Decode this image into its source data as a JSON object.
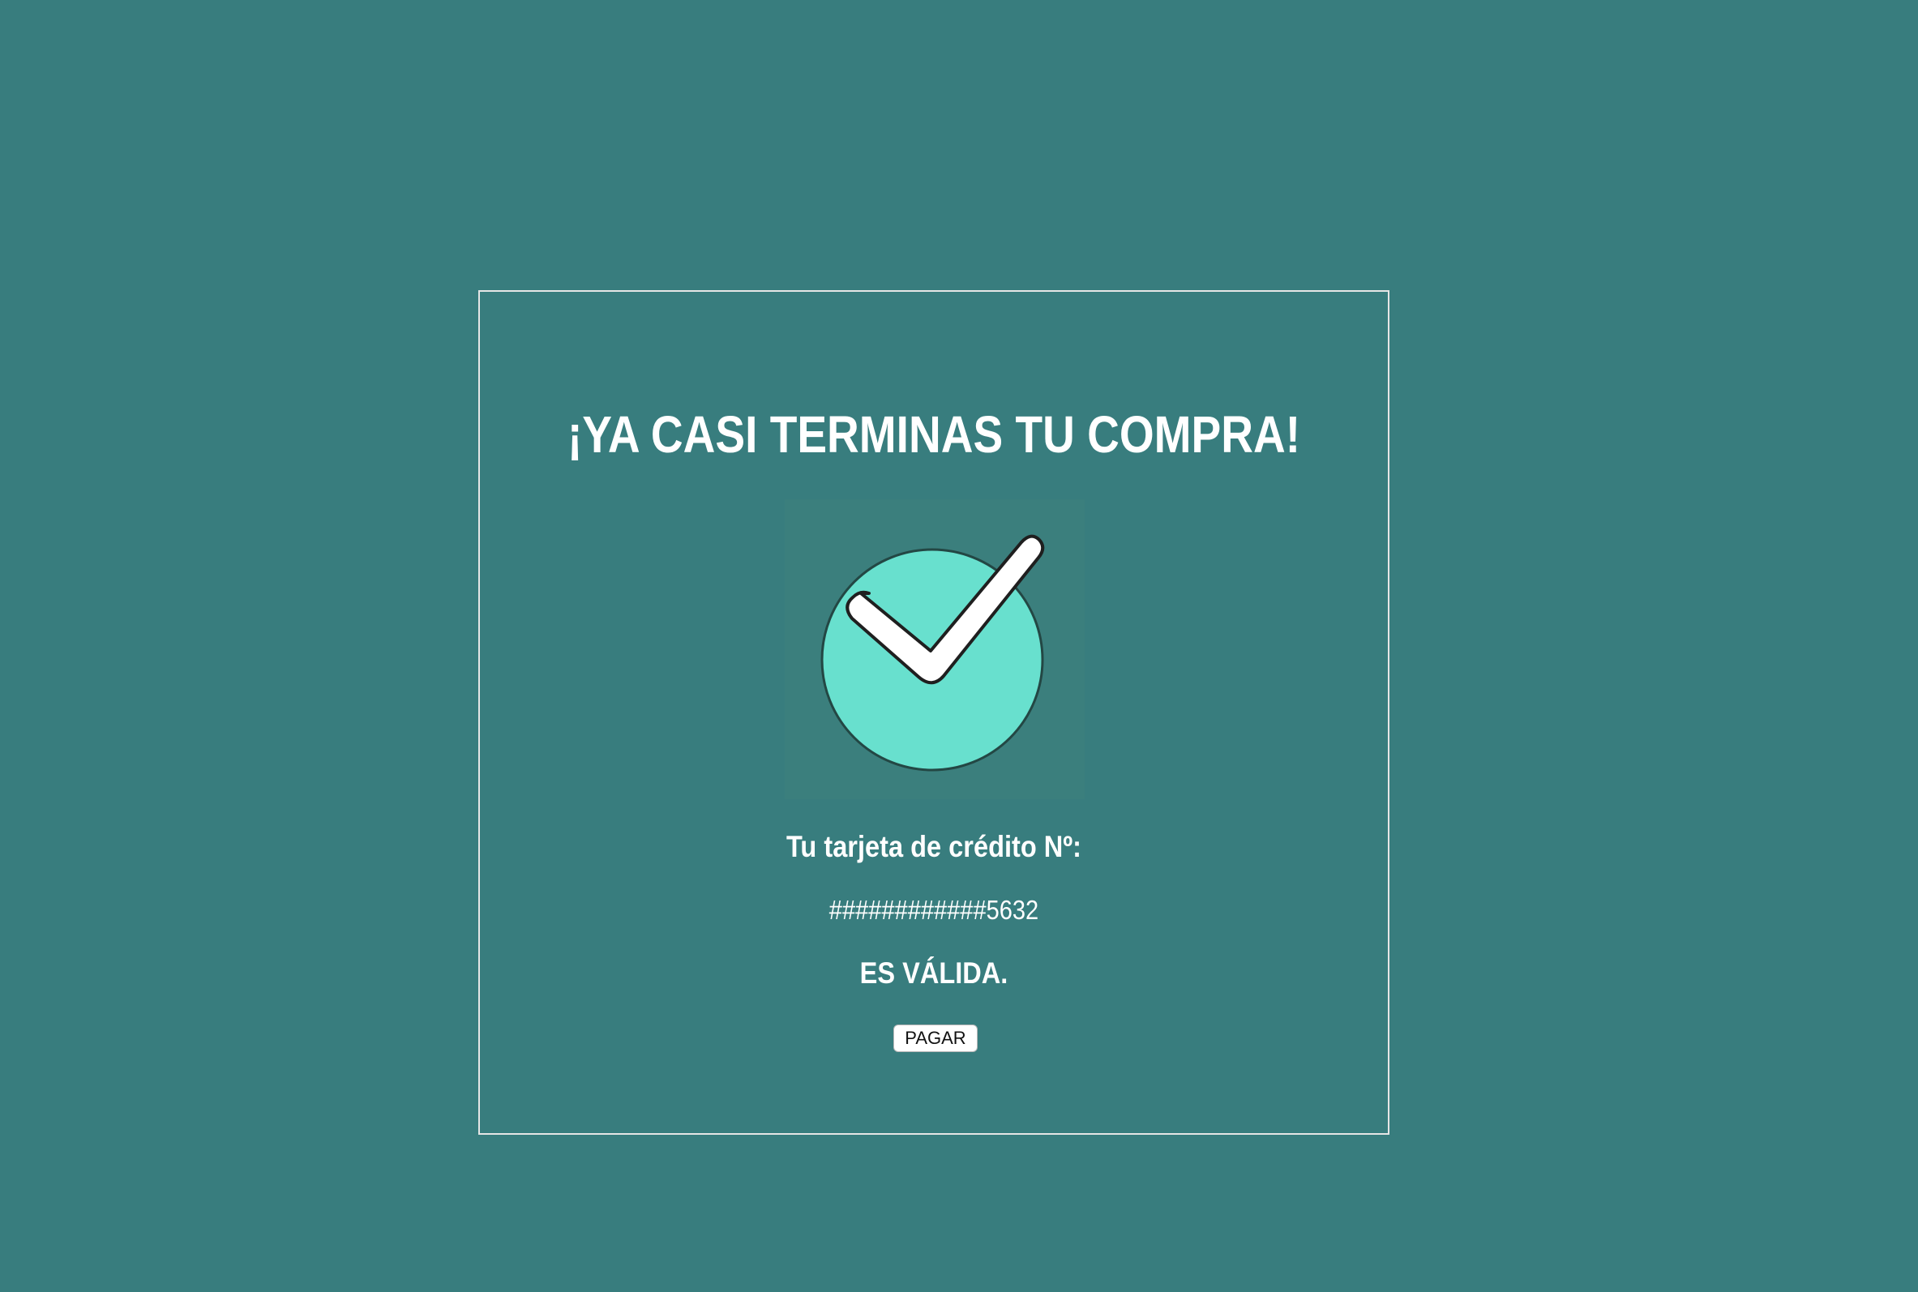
{
  "page": {
    "background_color": "#387d7e"
  },
  "card": {
    "title": "¡YA CASI TERMINAS TU COMPRA!",
    "icon": "check-circle-icon",
    "card_label": "Tu tarjeta de crédito Nº:",
    "card_number": "############5632",
    "status": "ES VÁLIDA.",
    "pay_button_label": "PAGAR"
  },
  "colors": {
    "check_circle": "#68e0ce",
    "check_mark": "#ffffff",
    "check_shadow": "#ef8fb0",
    "text": "#ffffff"
  }
}
